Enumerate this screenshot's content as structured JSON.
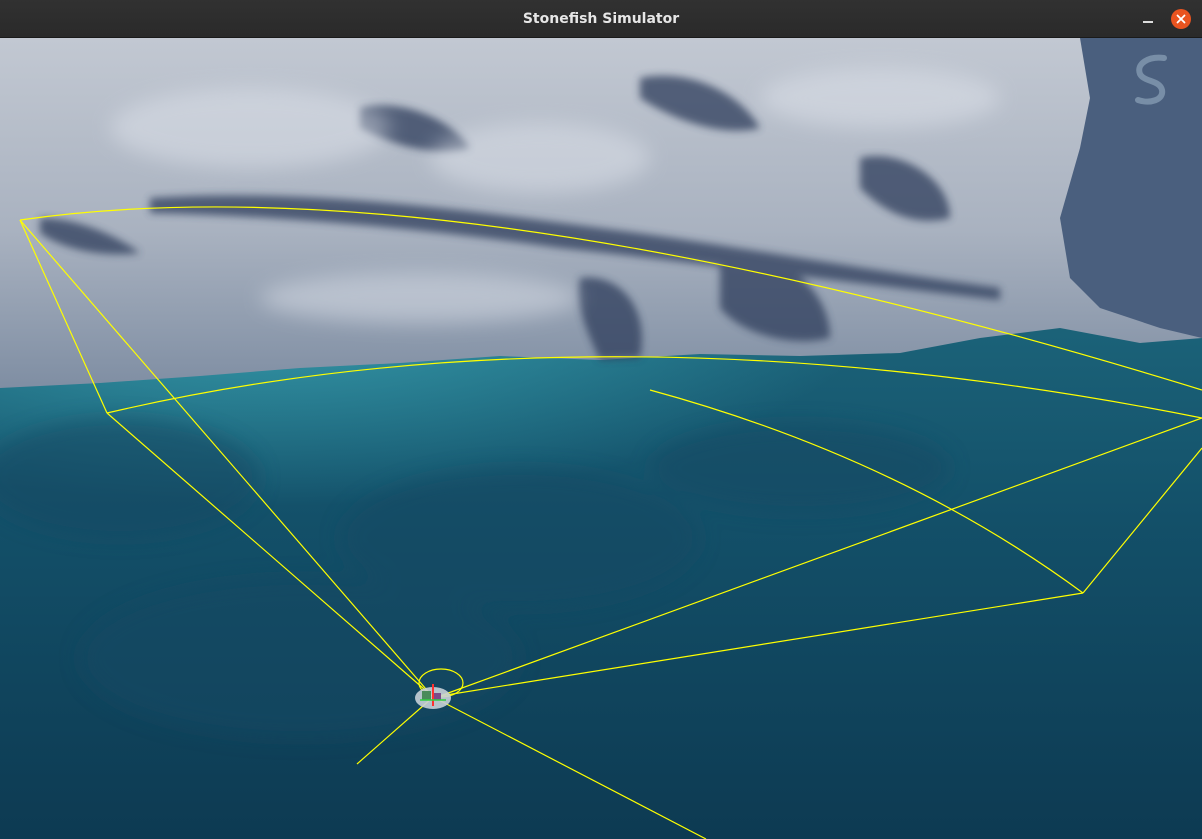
{
  "window": {
    "title": "Stonefish Simulator",
    "controls": {
      "minimize_icon": "minimize-icon",
      "close_icon": "close-icon",
      "close_color": "#e95420"
    }
  },
  "scene": {
    "sonar_color": "#ffff00",
    "water_color": "#0f3a4f",
    "rock_color": "#b4bcc8",
    "vehicle_icon": "rov-vehicle-icon",
    "watermark_icon": "stonefish-logo-icon"
  }
}
